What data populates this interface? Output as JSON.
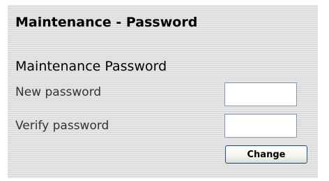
{
  "page": {
    "title": "Maintenance - Password"
  },
  "form": {
    "section_title": "Maintenance Password",
    "new_password": {
      "label": "New password",
      "value": ""
    },
    "verify_password": {
      "label": "Verify password",
      "value": ""
    },
    "change_label": "Change"
  }
}
